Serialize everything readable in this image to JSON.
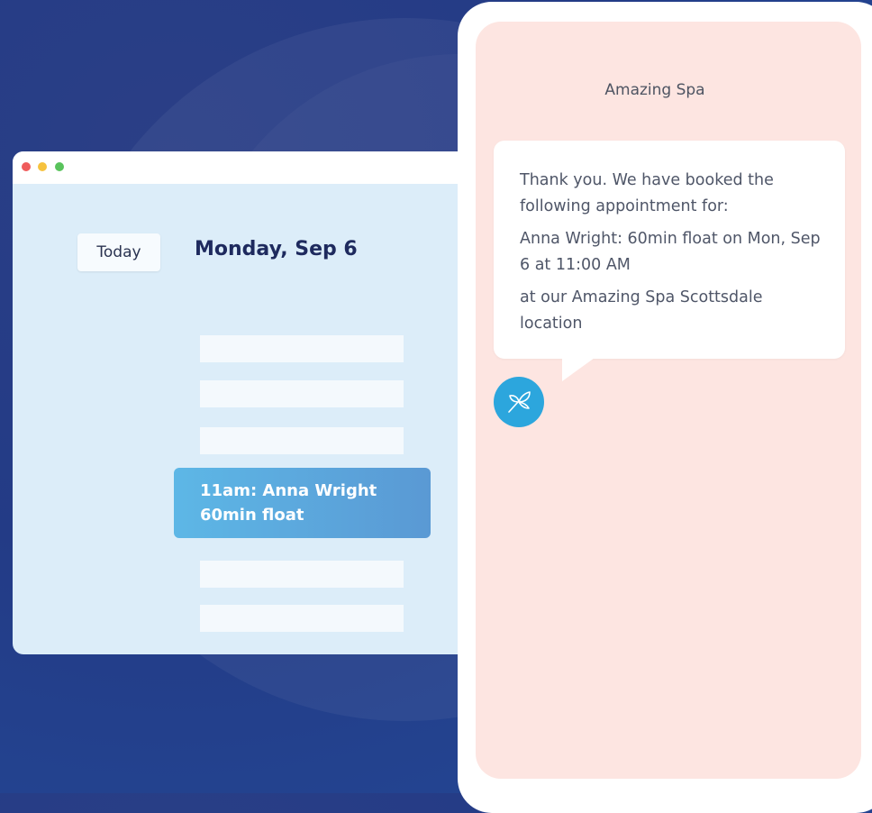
{
  "calendar": {
    "today_label": "Today",
    "date_title": "Monday, Sep 6",
    "appointment": {
      "line1": "11am: Anna Wright",
      "line2": "60min float"
    }
  },
  "phone": {
    "contact_name": "Amazing Spa",
    "message_paragraphs": [
      "Thank you. We have booked the following appointment for:",
      "Anna Wright: 60min float on Mon, Sep 6 at 11:00 AM",
      "at our Amazing Spa Scottsdale location"
    ],
    "avatar_icon": "leaf-logo-icon"
  },
  "colors": {
    "background": "#27408f",
    "calendar_bg": "#dcedf9",
    "appointment_start": "#5db7e6",
    "appointment_end": "#5a99d4",
    "phone_screen": "#fde5e1",
    "avatar": "#2ca6dd"
  }
}
